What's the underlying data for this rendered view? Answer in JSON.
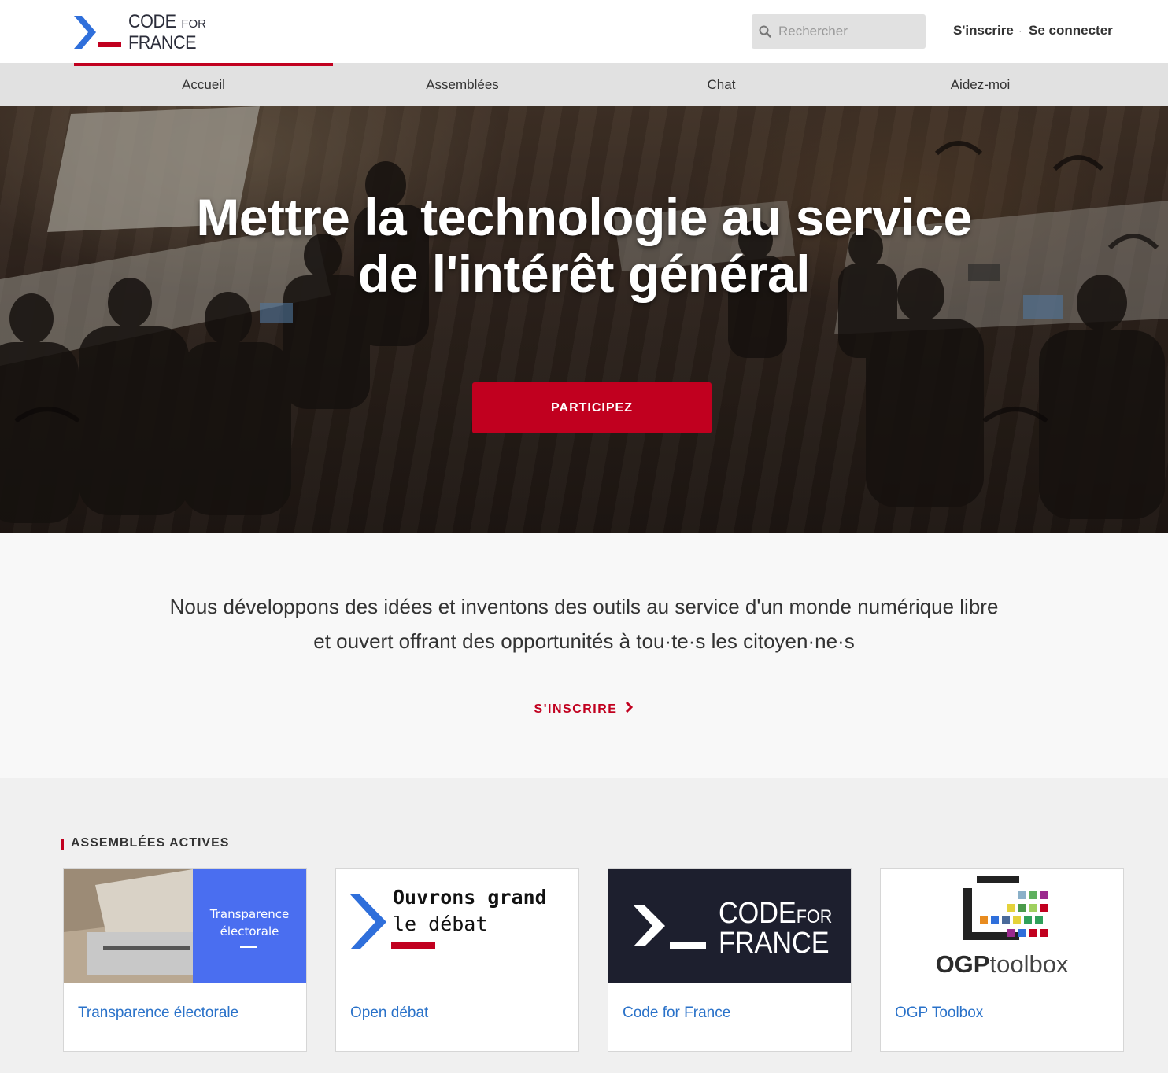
{
  "brand": {
    "line1_big": "CODE",
    "line1_small": "FOR",
    "line2": "FRANCE",
    "accent_red": "#c1001f",
    "accent_blue": "#2f6fdb"
  },
  "search": {
    "placeholder": "Rechercher"
  },
  "auth": {
    "signup": "S'inscrire",
    "separator": "·",
    "login": "Se connecter"
  },
  "nav": {
    "items": [
      {
        "label": "Accueil",
        "active": true
      },
      {
        "label": "Assemblées",
        "active": false
      },
      {
        "label": "Chat",
        "active": false
      },
      {
        "label": "Aidez-moi",
        "active": false
      }
    ]
  },
  "hero": {
    "title_line1": "Mettre la technologie au service",
    "title_line2": "de l'intérêt général",
    "cta": "PARTICIPEZ"
  },
  "intro": {
    "line1": "Nous développons des idées et inventons des outils au service d'un monde numérique libre",
    "line2": "et ouvert offrant des opportunités à tou·te·s les citoyen·ne·s",
    "link": "S'INSCRIRE"
  },
  "assemblies": {
    "heading": "ASSEMBLÉES ACTIVES",
    "cards": [
      {
        "title": "Transparence électorale",
        "image_text_line1": "Transparence",
        "image_text_line2": "électorale"
      },
      {
        "title": "Open débat",
        "image_text_line1": "Ouvrons grand",
        "image_text_line2": "le débat"
      },
      {
        "title": "Code for France",
        "image_text_line1_big": "CODE",
        "image_text_line1_small": "FOR",
        "image_text_line2": "FRANCE"
      },
      {
        "title": "OGP Toolbox",
        "image_text_strong": "OGP",
        "image_text_light": "toolbox"
      }
    ]
  }
}
